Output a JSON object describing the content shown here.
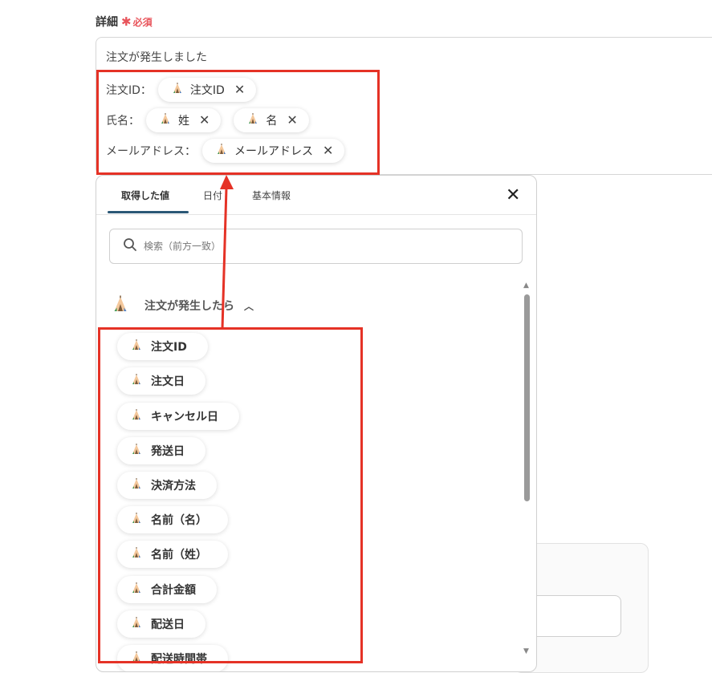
{
  "field": {
    "label": "詳細",
    "required": "必須"
  },
  "textarea": {
    "first_line": "注文が発生しました",
    "lines": [
      {
        "label": "注文ID：",
        "chips": [
          "注文ID"
        ]
      },
      {
        "label": "氏名：",
        "chips": [
          "姓",
          "名"
        ]
      },
      {
        "label": "メールアドレス：",
        "chips": [
          "メールアドレス"
        ]
      }
    ]
  },
  "panel": {
    "tabs": [
      "取得した値",
      "日付",
      "基本情報"
    ],
    "active_tab": "取得した値",
    "search_placeholder": "検索（前方一致）",
    "group_title": "注文が発生したら",
    "items": [
      "注文ID",
      "注文日",
      "キャンセル日",
      "発送日",
      "決済方法",
      "名前（名）",
      "名前（姓）",
      "合計金額",
      "配送日",
      "配送時間帯"
    ]
  },
  "colors": {
    "highlight": "#e53226",
    "required": "#e8545b",
    "tab_underline": "#2b5876"
  },
  "icons": {
    "chip": "tent-icon",
    "remove": "close-icon",
    "search": "search-icon",
    "collapse": "chevron-up-icon"
  }
}
